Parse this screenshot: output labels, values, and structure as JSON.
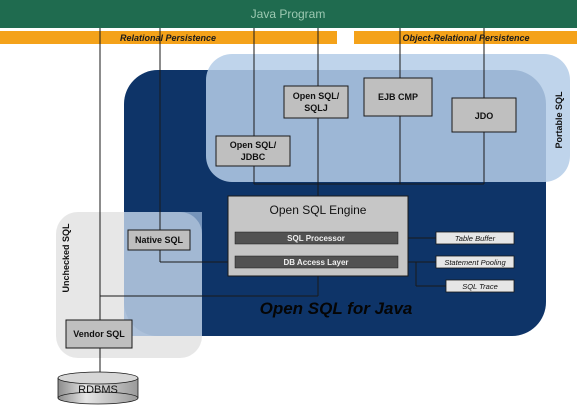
{
  "java_program": "Java Program",
  "persistence_bars": {
    "relational": "Relational Persistence",
    "object_relational": "Object-Relational Persistence"
  },
  "regions": {
    "portable_sql": "Portable SQL",
    "unchecked_sql": "Unchecked SQL",
    "open_sql_for_java": "Open SQL for Java"
  },
  "apis": {
    "open_sql_sqlj": [
      "Open SQL/",
      "SQLJ"
    ],
    "ejb_cmp": "EJB CMP",
    "jdo": "JDO",
    "open_sql_jdbc": [
      "Open SQL/",
      "JDBC"
    ],
    "native_sql": "Native SQL",
    "vendor_sql": "Vendor SQL"
  },
  "engine": {
    "title": "Open SQL Engine",
    "sql_processor": "SQL Processor",
    "db_access_layer": "DB Access Layer"
  },
  "services": {
    "table_buffer": "Table Buffer",
    "statement_pooling": "Statement Pooling",
    "sql_trace": "SQL Trace"
  },
  "database": "RDBMS",
  "colors": {
    "java_bar": "#1f6b4f",
    "java_text": "#9cc9b2",
    "orange": "#f4a21a",
    "dark_navy": "#0e3468",
    "portable_fill": "#a9c4e2",
    "unchecked_fill": "#dcdcdc",
    "box_gray": "#bfbfbf",
    "engine_bar": "#525252"
  }
}
